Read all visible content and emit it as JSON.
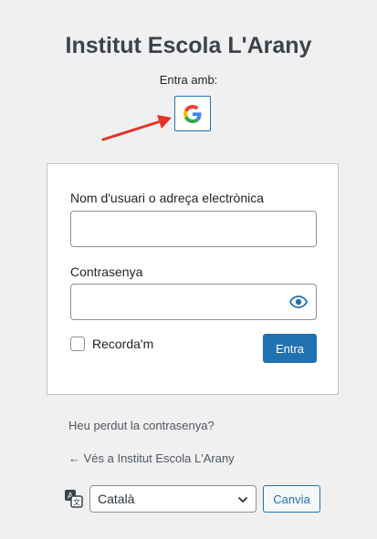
{
  "site": {
    "title": "Institut Escola L'Arany"
  },
  "social": {
    "label": "Entra amb:",
    "provider_icon": "google-icon"
  },
  "form": {
    "username_label": "Nom d'usuari o adreça electrònica",
    "username_value": "",
    "password_label": "Contrasenya",
    "password_value": "",
    "remember_label": "Recorda'm",
    "submit_label": "Entra"
  },
  "links": {
    "lost_password": "Heu perdut la contrasenya?",
    "back_to_site": "← Vés a Institut Escola L'Arany"
  },
  "language": {
    "selected": "Català",
    "change_button": "Canvia"
  },
  "colors": {
    "accent": "#2271b1",
    "background": "#f0f0f1",
    "arrow": "#e8322a"
  }
}
